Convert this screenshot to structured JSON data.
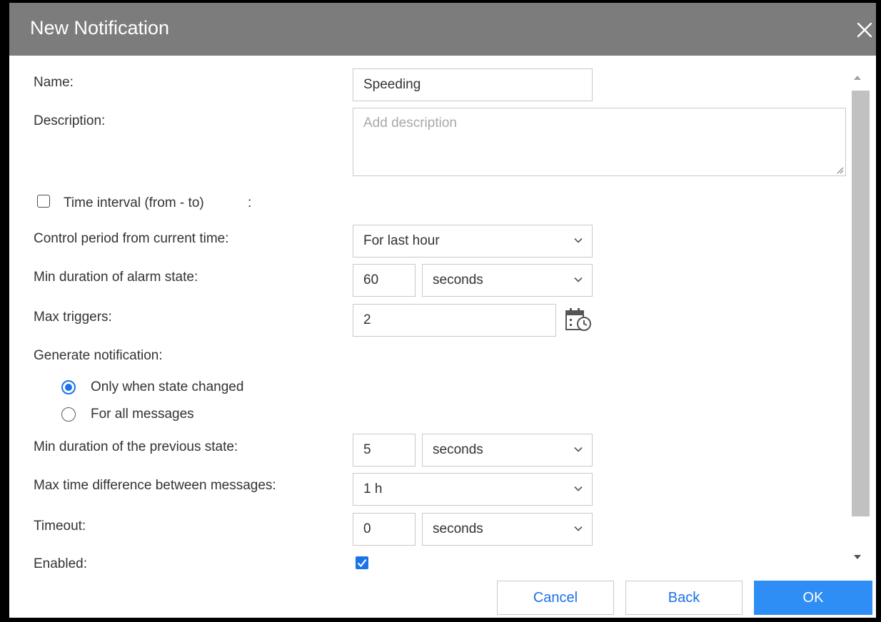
{
  "dialog": {
    "title": "New Notification"
  },
  "fields": {
    "name": {
      "label": "Name:",
      "value": "Speeding"
    },
    "description": {
      "label": "Description:",
      "placeholder": "Add description"
    },
    "time_interval": {
      "label": "Time interval (from - to)",
      "suffix": ":",
      "checked": false
    },
    "control_period": {
      "label": "Control period from current time:",
      "value": "For last hour"
    },
    "min_alarm_duration": {
      "label": "Min duration of alarm state:",
      "value": "60",
      "unit": "seconds"
    },
    "max_triggers": {
      "label": "Max triggers:",
      "value": "2"
    },
    "generate": {
      "label": "Generate notification:",
      "options": [
        {
          "label": "Only when state changed",
          "selected": true
        },
        {
          "label": "For all messages",
          "selected": false
        }
      ]
    },
    "min_prev_duration": {
      "label": "Min duration of the previous state:",
      "value": "5",
      "unit": "seconds"
    },
    "max_time_diff": {
      "label": "Max time difference between messages:",
      "value": "1 h"
    },
    "timeout": {
      "label": "Timeout:",
      "value": "0",
      "unit": "seconds"
    },
    "enabled": {
      "label": "Enabled:",
      "checked": true
    }
  },
  "buttons": {
    "cancel": "Cancel",
    "back": "Back",
    "ok": "OK"
  },
  "icons": {
    "close": "close-icon",
    "schedule": "calendar-clock-icon",
    "dropdown": "chevron-down-icon",
    "check": "check-icon"
  },
  "colors": {
    "titlebar": "#7c7c7c",
    "accent": "#1a73e8",
    "primary_button": "#2e8ef5",
    "scrollbar_thumb": "#c1c1c1"
  }
}
